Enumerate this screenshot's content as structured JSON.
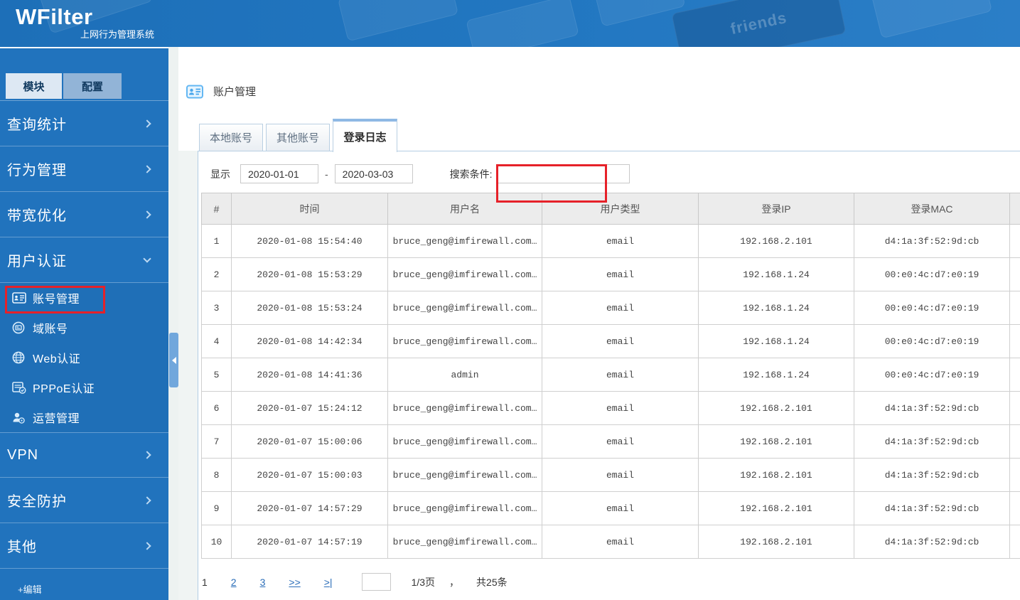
{
  "banner": {
    "logo": "WFilter",
    "subtitle": "上网行为管理系统",
    "keyboard_key_label": "friends"
  },
  "sidebar": {
    "tabs": [
      {
        "label": "模块"
      },
      {
        "label": "配置"
      }
    ],
    "sections": [
      {
        "label": "查询统计"
      },
      {
        "label": "行为管理"
      },
      {
        "label": "带宽优化"
      },
      {
        "label": "用户认证"
      },
      {
        "label": "VPN"
      },
      {
        "label": "安全防护"
      },
      {
        "label": "其他"
      }
    ],
    "submenu": [
      {
        "label": "账号管理",
        "icon": "id-card-icon",
        "highlighted": true
      },
      {
        "label": "域账号",
        "icon": "domain-account-icon"
      },
      {
        "label": "Web认证",
        "icon": "globe-icon"
      },
      {
        "label": "PPPoE认证",
        "icon": "pppoe-doc-check-icon"
      },
      {
        "label": "运营管理",
        "icon": "operator-user-icon"
      }
    ],
    "edit_label": "+编辑"
  },
  "main": {
    "page_title": "账户管理",
    "tabs": [
      {
        "label": "本地账号"
      },
      {
        "label": "其他账号"
      },
      {
        "label": "登录日志",
        "active": true
      }
    ],
    "filters": {
      "show_label": "显示",
      "date_from": "2020-01-01",
      "date_separator": "-",
      "date_to": "2020-03-03",
      "search_label": "搜索条件:",
      "search_value": ""
    },
    "table": {
      "columns": [
        "#",
        "时间",
        "用户名",
        "用户类型",
        "登录IP",
        "登录MAC"
      ],
      "rows": [
        [
          "1",
          "2020-01-08 15:54:40",
          "bruce_geng@imfirewall.com…",
          "email",
          "192.168.2.101",
          "d4:1a:3f:52:9d:cb"
        ],
        [
          "2",
          "2020-01-08 15:53:29",
          "bruce_geng@imfirewall.com…",
          "email",
          "192.168.1.24",
          "00:e0:4c:d7:e0:19"
        ],
        [
          "3",
          "2020-01-08 15:53:24",
          "bruce_geng@imfirewall.com…",
          "email",
          "192.168.1.24",
          "00:e0:4c:d7:e0:19"
        ],
        [
          "4",
          "2020-01-08 14:42:34",
          "bruce_geng@imfirewall.com…",
          "email",
          "192.168.1.24",
          "00:e0:4c:d7:e0:19"
        ],
        [
          "5",
          "2020-01-08 14:41:36",
          "admin",
          "email",
          "192.168.1.24",
          "00:e0:4c:d7:e0:19"
        ],
        [
          "6",
          "2020-01-07 15:24:12",
          "bruce_geng@imfirewall.com…",
          "email",
          "192.168.2.101",
          "d4:1a:3f:52:9d:cb"
        ],
        [
          "7",
          "2020-01-07 15:00:06",
          "bruce_geng@imfirewall.com…",
          "email",
          "192.168.2.101",
          "d4:1a:3f:52:9d:cb"
        ],
        [
          "8",
          "2020-01-07 15:00:03",
          "bruce_geng@imfirewall.com…",
          "email",
          "192.168.2.101",
          "d4:1a:3f:52:9d:cb"
        ],
        [
          "9",
          "2020-01-07 14:57:29",
          "bruce_geng@imfirewall.com…",
          "email",
          "192.168.2.101",
          "d4:1a:3f:52:9d:cb"
        ],
        [
          "10",
          "2020-01-07 14:57:19",
          "bruce_geng@imfirewall.com…",
          "email",
          "192.168.2.101",
          "d4:1a:3f:52:9d:cb"
        ]
      ]
    },
    "pagination": {
      "current": "1",
      "page_links": [
        "2",
        "3"
      ],
      "next_label": ">>",
      "last_label": ">|",
      "jump_value": "",
      "page_info": "1/3页",
      "comma": "，",
      "total_info": "共25条"
    }
  },
  "colors": {
    "banner_blue": "#2173bd",
    "sidebar_blue": "#2173bd",
    "sidebar_tab_active_bg": "#dde8f3",
    "sidebar_tab_inactive_bg": "#92b4d7",
    "panel_border": "#b3cde4",
    "tab_active_top_border": "#8fb9e4",
    "annotation_red": "#e62129",
    "link_blue": "#2a6db8",
    "table_header_bg": "#ececec"
  }
}
